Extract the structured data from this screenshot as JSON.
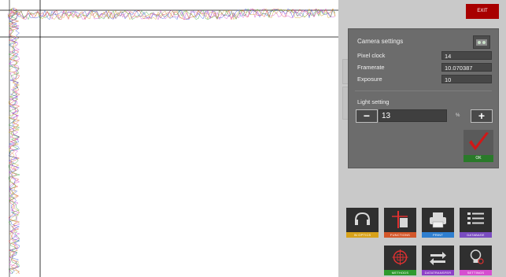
{
  "header": {
    "exit_label": "EXIT"
  },
  "camera_dialog": {
    "title": "Camera settings",
    "rows": [
      {
        "label": "Pixel clock",
        "value": "14"
      },
      {
        "label": "Framerate",
        "value": "10.070387"
      },
      {
        "label": "Exposure",
        "value": "10"
      }
    ],
    "light": {
      "label": "Light setting",
      "value": "13",
      "unit": "%"
    },
    "ok_label": "OK"
  },
  "toolbar": {
    "tiles": [
      {
        "label": "IN OPTICS",
        "color": "#d8a21a",
        "icon": "headset-icon"
      },
      {
        "label": "FUNCTIONS",
        "color": "#d4572a",
        "icon": "cursor-icon"
      },
      {
        "label": "PRINT",
        "color": "#2f7fd0",
        "icon": "printer-icon"
      },
      {
        "label": "DATABASE",
        "color": "#7a4cc0",
        "icon": "list-icon"
      },
      {
        "label": "METHODS",
        "color": "#2e9a2e",
        "icon": "target-icon"
      },
      {
        "label": "DATATRANSFER",
        "color": "#8d3fc7",
        "icon": "transfer-icon"
      },
      {
        "label": "SETTINGS",
        "color": "#d64fd0",
        "icon": "lightbulb-icon"
      }
    ]
  }
}
